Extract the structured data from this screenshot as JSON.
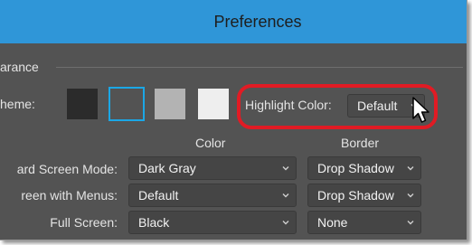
{
  "dialog": {
    "title": "Preferences"
  },
  "appearance": {
    "section_label": "arance",
    "theme_label": "heme:",
    "themes": [
      {
        "name": "darkest",
        "color": "#2b2b2b",
        "selected": false
      },
      {
        "name": "dark",
        "color": "#535353",
        "selected": true
      },
      {
        "name": "medium",
        "color": "#b3b3b3",
        "selected": false
      },
      {
        "name": "light",
        "color": "#eeeeee",
        "selected": false
      }
    ],
    "highlight_label": "Highlight Color:",
    "highlight_value": "Default"
  },
  "columns": {
    "color": "Color",
    "border": "Border"
  },
  "rows": [
    {
      "label": "ard Screen Mode:",
      "color": "Dark Gray",
      "border": "Drop Shadow"
    },
    {
      "label": "reen with Menus:",
      "color": "Default",
      "border": "Drop Shadow"
    },
    {
      "label": "Full Screen:",
      "color": "Black",
      "border": "None"
    }
  ],
  "colors": {
    "title_bar": "#2f96d8",
    "panel": "#535353",
    "selection_border": "#1ba7e6",
    "annotation_ring": "#e11b24"
  },
  "icons": {
    "dropdown": "chevron-down-icon",
    "pointer": "mouse-cursor-icon"
  }
}
